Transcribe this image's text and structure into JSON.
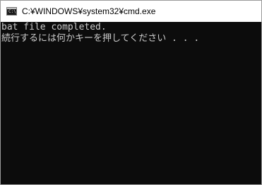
{
  "window": {
    "title": "C:¥WINDOWS¥system32¥cmd.exe",
    "icon": "cmd-icon"
  },
  "console": {
    "lines": [
      "bat file completed.",
      "続行するには何かキーを押してください . . ."
    ],
    "text_color": "#cccccc",
    "background_color": "#0c0c0c"
  }
}
